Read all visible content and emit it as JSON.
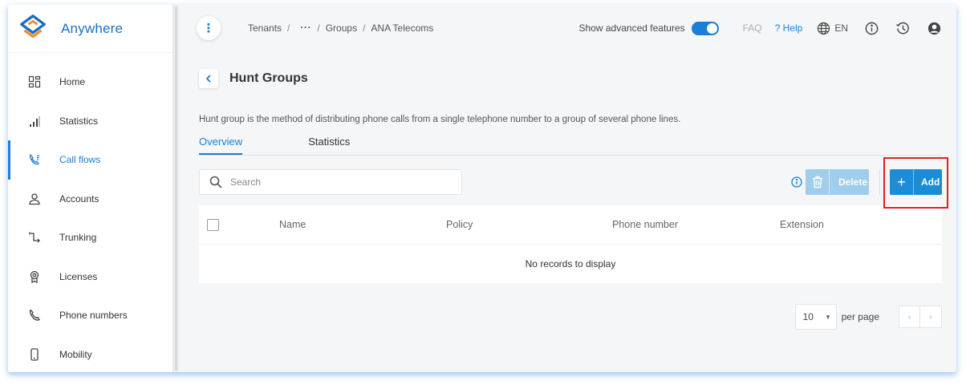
{
  "brand": {
    "name": "Anywhere"
  },
  "sidebar": {
    "items": [
      {
        "label": "Home",
        "icon": "grid-icon"
      },
      {
        "label": "Statistics",
        "icon": "bar-chart-icon"
      },
      {
        "label": "Call flows",
        "icon": "call-flow-icon",
        "active": true
      },
      {
        "label": "Accounts",
        "icon": "user-icon"
      },
      {
        "label": "Trunking",
        "icon": "trunk-icon"
      },
      {
        "label": "Licenses",
        "icon": "license-icon"
      },
      {
        "label": "Phone numbers",
        "icon": "phone-icon"
      },
      {
        "label": "Mobility",
        "icon": "mobile-icon"
      }
    ]
  },
  "header": {
    "breadcrumb": [
      "Tenants",
      "···",
      "Groups",
      "ANA Telecoms"
    ],
    "advanced_label": "Show advanced features",
    "advanced_on": true,
    "faq": "FAQ",
    "help": "? Help",
    "lang": "EN"
  },
  "page": {
    "title": "Hunt Groups",
    "description": "Hunt group is the method of distributing phone calls from a single telephone number to a group of several phone lines.",
    "tabs": [
      {
        "label": "Overview",
        "active": true
      },
      {
        "label": "Statistics",
        "active": false
      }
    ]
  },
  "toolbar": {
    "search_placeholder": "Search",
    "delete_label": "Delete",
    "add_label": "Add"
  },
  "table": {
    "columns": [
      "Name",
      "Policy",
      "Phone number",
      "Extension"
    ],
    "empty_text": "No records to display"
  },
  "pagination": {
    "page_size": "10",
    "per_page_label": "per page",
    "prev": "‹",
    "next": "›"
  },
  "colors": {
    "accent": "#1a7fd6",
    "add_button": "#1a8cd8",
    "delete_button_disabled": "#9fcdec",
    "highlight": "#e02020"
  }
}
